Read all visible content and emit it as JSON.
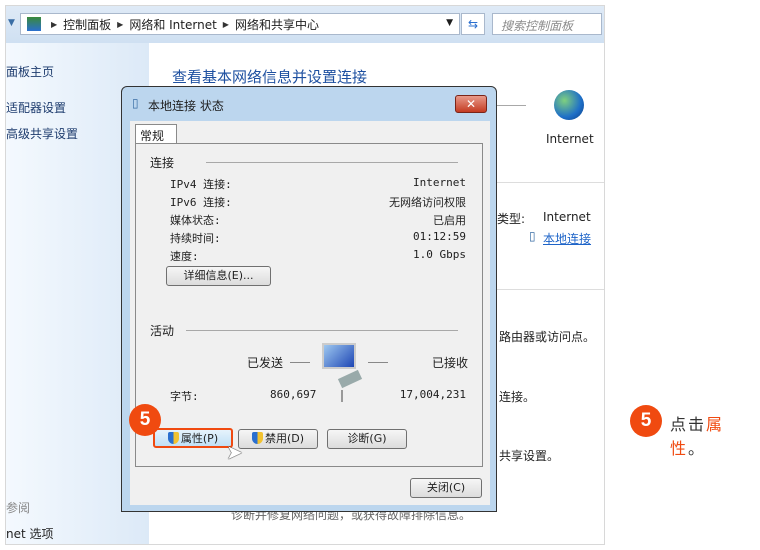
{
  "address_bar": {
    "breadcrumbs": [
      "控制面板",
      "网络和 Internet",
      "网络和共享中心"
    ],
    "search_placeholder": "搜索控制面板"
  },
  "sidebar": {
    "items": [
      "面板主页",
      "适配器设置",
      "高级共享设置"
    ],
    "see_also": "参阅",
    "bottom_item": "net 选项"
  },
  "content": {
    "title": "查看基本网络信息并设置连接",
    "internet_label": "Internet",
    "access_type_label": "类型:",
    "access_type_value": "Internet",
    "connection_link": "本地连接",
    "text1": "路由器或访问点。",
    "text2": "连接。",
    "text3": "共享设置。",
    "text4": "诊断并修复网络问题，或获得故障排除信息。"
  },
  "dialog": {
    "title": "本地连接 状态",
    "tab": "常规",
    "connection_section": "连接",
    "rows": [
      {
        "label": "IPv4 连接:",
        "value": "Internet"
      },
      {
        "label": "IPv6 连接:",
        "value": "无网络访问权限"
      },
      {
        "label": "媒体状态:",
        "value": "已启用"
      },
      {
        "label": "持续时间:",
        "value": "01:12:59"
      },
      {
        "label": "速度:",
        "value": "1.0 Gbps"
      }
    ],
    "details_button": "详细信息(E)...",
    "activity_section": "活动",
    "sent_label": "已发送",
    "received_label": "已接收",
    "bytes_label": "字节:",
    "bytes_sent": "860,697",
    "bytes_received": "17,004,231",
    "properties_button": "属性(P)",
    "disable_button": "禁用(D)",
    "diagnose_button": "诊断(G)",
    "close_button": "关闭(C)"
  },
  "annotation": {
    "step": "5",
    "text_prefix": "点击",
    "text_highlight": "属性",
    "text_suffix": "。",
    "accent": "#f04a10"
  }
}
